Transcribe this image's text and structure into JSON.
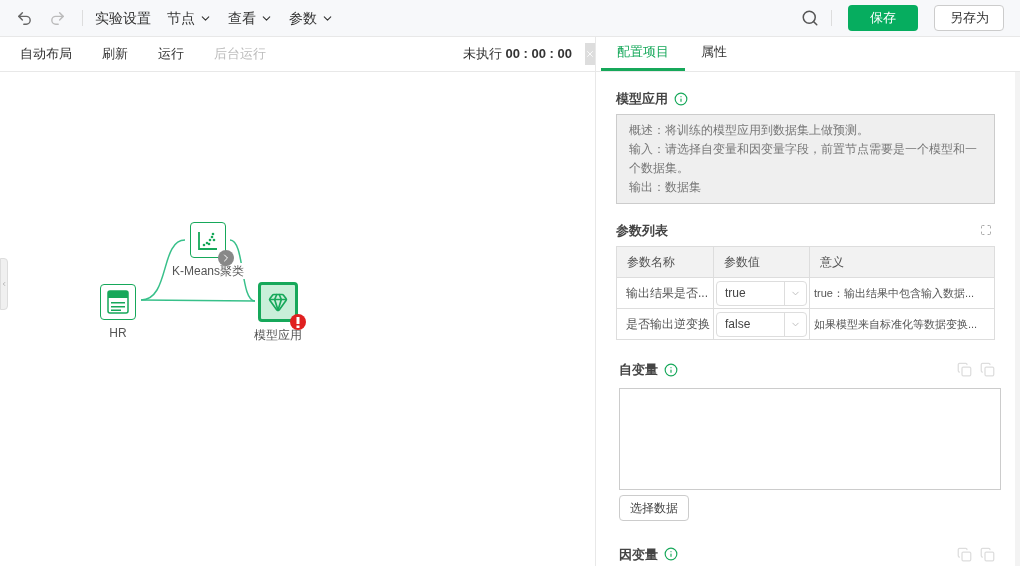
{
  "top_menu": [
    {
      "label": "实验设置",
      "dropdown": false
    },
    {
      "label": "节点",
      "dropdown": true
    },
    {
      "label": "查看",
      "dropdown": true
    },
    {
      "label": "参数",
      "dropdown": true
    }
  ],
  "actions": {
    "save": "保存",
    "save_as": "另存为"
  },
  "toolbar": [
    {
      "label": "自动布局",
      "disabled": false
    },
    {
      "label": "刷新",
      "disabled": false
    },
    {
      "label": "运行",
      "disabled": false
    },
    {
      "label": "后台运行",
      "disabled": true
    }
  ],
  "run_status": {
    "label": "未执行",
    "time": "00 : 00 : 00"
  },
  "tabs": [
    {
      "label": "配置项目",
      "selected": true
    },
    {
      "label": "属性",
      "selected": false
    }
  ],
  "nodes": [
    {
      "label": "K-Means聚类",
      "kind": "scatter",
      "selected": false,
      "next_arrow": true,
      "error": false
    },
    {
      "label": "HR",
      "kind": "sql",
      "selected": false,
      "next_arrow": false,
      "error": false
    },
    {
      "label": "模型应用",
      "kind": "gem",
      "selected": true,
      "next_arrow": false,
      "error": true
    }
  ],
  "panel": {
    "title": "模型应用",
    "description": [
      "概述：将训练的模型应用到数据集上做预测。",
      "输入：请选择自变量和因变量字段，前置节点需要是一个模型和一个数据集。",
      "输出：数据集"
    ],
    "params_title": "参数列表",
    "param_columns": [
      "参数名称",
      "参数值",
      "意义"
    ],
    "param_rows": [
      {
        "name": "输出结果是否...",
        "value": "true",
        "meaning": "true：输出结果中包含输入数据..."
      },
      {
        "name": "是否输出逆变换",
        "value": "false",
        "meaning": "如果模型来自标准化等数据变换..."
      }
    ],
    "x_title": "自变量",
    "select_button": "选择数据",
    "y_title": "因变量"
  }
}
